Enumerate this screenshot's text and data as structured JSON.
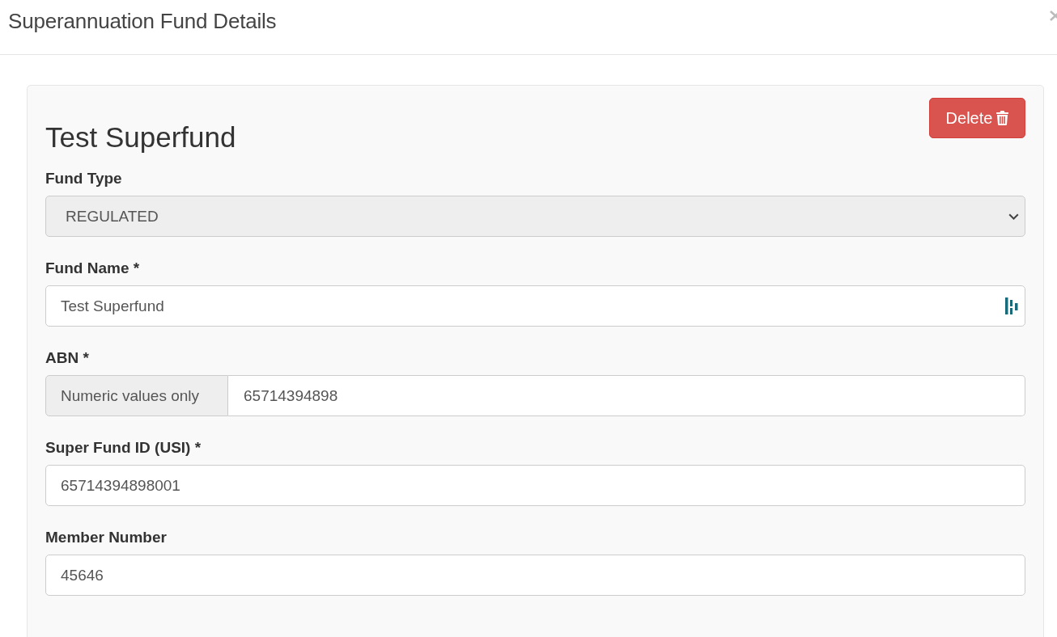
{
  "dialog": {
    "title": "Superannuation Fund Details"
  },
  "fund_card": {
    "heading": "Test Superfund",
    "delete_button": "Delete",
    "fields": [
      {
        "kind": "select",
        "label": "Fund Type",
        "value": "REGULATED",
        "disabled": true
      },
      {
        "kind": "text_icon",
        "label": "Fund Name *",
        "value": "Test Superfund"
      },
      {
        "kind": "addon",
        "label": "ABN *",
        "addon": "Numeric values only",
        "value": "65714394898"
      },
      {
        "kind": "text",
        "label": "Super Fund ID (USI) *",
        "value": "65714394898001"
      },
      {
        "kind": "text",
        "label": "Member Number",
        "value": "45646"
      }
    ]
  }
}
